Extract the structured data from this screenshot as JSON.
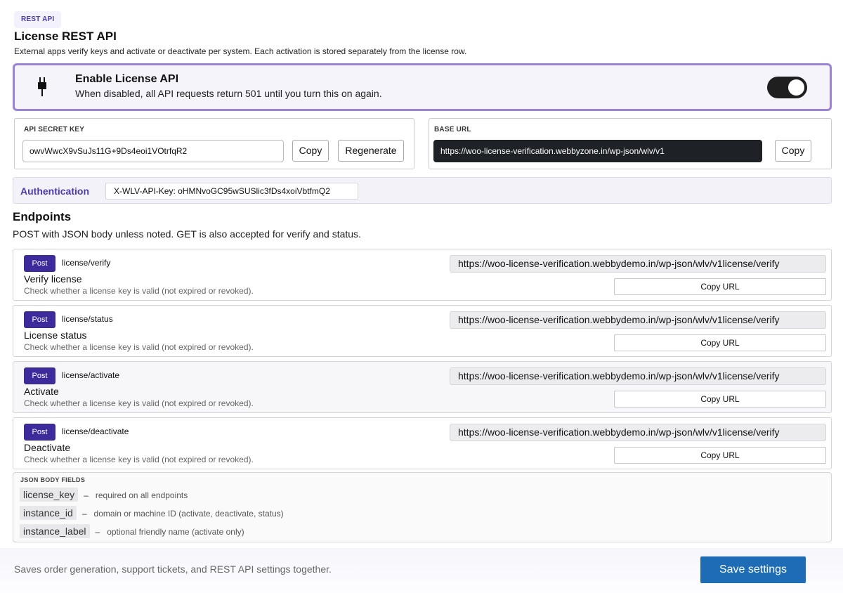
{
  "header": {
    "badge": "REST API",
    "title": "License REST API",
    "subtitle": "External apps verify keys and activate or deactivate per system. Each activation is stored separately from the license row."
  },
  "enable": {
    "icon": "plug-icon",
    "title": "Enable License API",
    "subtitle": "When disabled, all API requests return 501 until you turn this on again.",
    "enabled": true
  },
  "secret": {
    "label": "API SECRET KEY",
    "value": "owvWwcX9vSuJs11G+9Ds4eoi1VOtrfqR2",
    "copy_label": "Copy",
    "regenerate_label": "Regenerate"
  },
  "base_url": {
    "label": "BASE URL",
    "value": "https://woo-license-verification.webbyzone.in/wp-json/wlv/v1",
    "copy_label": "Copy"
  },
  "auth": {
    "label": "Authentication",
    "value": "X-WLV-API-Key: oHMNvoGC95wSUSlic3fDs4xoiVbtfmQ2"
  },
  "endpoints_section": {
    "title": "Endpoints",
    "subtitle": "POST with JSON body unless noted. GET is also accepted for verify and status."
  },
  "endpoints": [
    {
      "method": "Post",
      "path": "license/verify",
      "name": "Verify license",
      "description": "Check whether a license key is valid (not expired or revoked).",
      "url": "https://woo-license-verification.webbydemo.in/wp-json/wlv/v1license/verify",
      "copy_label": "Copy URL"
    },
    {
      "method": "Post",
      "path": "license/status",
      "name": "License status",
      "description": "Check whether a license key is valid (not expired or revoked).",
      "url": "https://woo-license-verification.webbydemo.in/wp-json/wlv/v1license/verify",
      "copy_label": "Copy URL"
    },
    {
      "method": "Post",
      "path": "license/activate",
      "name": "Activate",
      "description": "Check whether a license key is valid (not expired or revoked).",
      "url": "https://woo-license-verification.webbydemo.in/wp-json/wlv/v1license/verify",
      "copy_label": "Copy URL"
    },
    {
      "method": "Post",
      "path": "license/deactivate",
      "name": "Deactivate",
      "description": "Check whether a license key is valid (not expired or revoked).",
      "url": "https://woo-license-verification.webbydemo.in/wp-json/wlv/v1license/verify",
      "copy_label": "Copy URL"
    }
  ],
  "json_fields": {
    "label": "JSON BODY FIELDS",
    "dash": "–",
    "fields": [
      {
        "name": "license_key",
        "description": "required on all endpoints"
      },
      {
        "name": "instance_id",
        "description": "domain or machine ID (activate, deactivate, status)"
      },
      {
        "name": "instance_label",
        "description": "optional friendly name (activate only)"
      }
    ]
  },
  "footer": {
    "text": "Saves order generation, support tickets, and REST API settings together.",
    "save_label": "Save settings"
  },
  "colors": {
    "accent": "#3d2a9b",
    "enable_border": "#9b82d6",
    "save_button": "#1d6cb5"
  }
}
